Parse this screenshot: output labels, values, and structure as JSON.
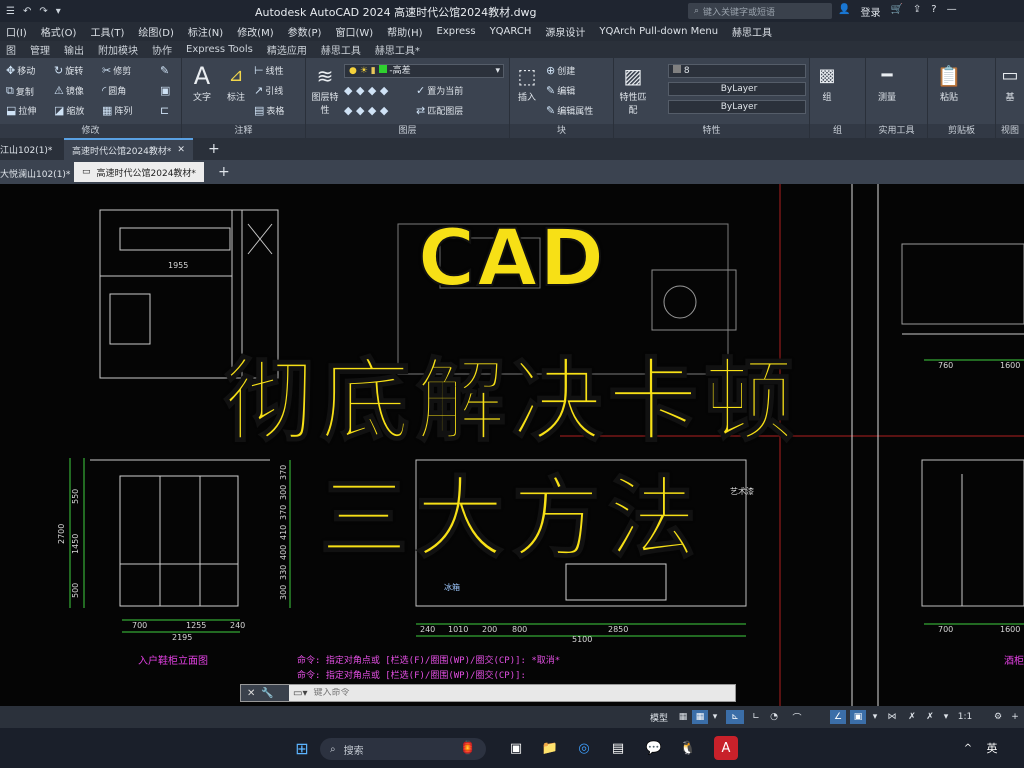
{
  "titlebar": {
    "title": "Autodesk AutoCAD 2024    高速时代公馆2024教材.dwg",
    "search_placeholder": "键入关键字或短语",
    "login": "登录"
  },
  "menubar": [
    "口(I)",
    "格式(O)",
    "工具(T)",
    "绘图(D)",
    "标注(N)",
    "修改(M)",
    "参数(P)",
    "窗口(W)",
    "帮助(H)",
    "Express",
    "YQARCH",
    "源泉设计",
    "YQArch Pull-down Menu",
    "赫思工具"
  ],
  "ribbon_tabs": [
    "图",
    "管理",
    "输出",
    "附加模块",
    "协作",
    "Express Tools",
    "精选应用",
    "赫思工具",
    "赫思工具*"
  ],
  "ribbon": {
    "modify": {
      "title": "修改",
      "buttons": [
        "移动",
        "旋转",
        "修剪",
        "复制",
        "镜像",
        "圆角",
        "拉伸",
        "缩放",
        "阵列"
      ]
    },
    "annotation": {
      "title": "注释",
      "text": "文字",
      "dim": "标注",
      "linear": "线性",
      "leader": "引线",
      "table": "表格"
    },
    "layers": {
      "title": "图层",
      "props": "图层特性",
      "current_layer": "-高差",
      "set_current": "置为当前",
      "match": "匹配图层"
    },
    "block": {
      "title": "块",
      "insert": "插入",
      "create": "创建",
      "edit": "编辑",
      "edit_attr": "编辑属性"
    },
    "properties": {
      "title": "特性",
      "match": "特性匹配",
      "color": "8",
      "linetype": "ByLayer",
      "lineweight": "ByLayer"
    },
    "group": {
      "title": "组",
      "label": "组"
    },
    "utilities": {
      "title": "实用工具",
      "measure": "测量"
    },
    "clipboard": {
      "title": "剪贴板",
      "paste": "粘贴"
    },
    "view": {
      "title": "视图",
      "base": "基"
    }
  },
  "file_tabs_top": [
    "江山102(1)*",
    "高速时代公馆2024教材*"
  ],
  "file_tabs_bottom": [
    "大悦澜山102(1)*",
    "高速时代公馆2024教材*"
  ],
  "drawing_labels": {
    "dim_1955": "1955",
    "left_dims_bottom": [
      "700",
      "1255",
      "240"
    ],
    "left_total": "2195",
    "left_vert": [
      "550",
      "1450",
      "500",
      "2700"
    ],
    "mid_vert": [
      "370",
      "300",
      "370",
      "410",
      "400",
      "330",
      "300"
    ],
    "mid_dims": [
      "240",
      "1010",
      "200",
      "800",
      "2850"
    ],
    "mid_total": "5100",
    "right_dims": [
      "760",
      "1600"
    ],
    "right_dims_bottom": [
      "700",
      "1600"
    ],
    "left_caption": "入户鞋柜立面图",
    "mid_label": "冰箱",
    "mid_label2": "艺术漆",
    "right_caption": "酒柜"
  },
  "headline": [
    "CAD",
    "彻底解决卡顿",
    "三大方法"
  ],
  "command_history": [
    "命令: 指定对角点或 [栏选(F)/圈围(WP)/圈交(CP)]: *取消*",
    "命令: 指定对角点或 [栏选(F)/圈围(WP)/圈交(CP)]:"
  ],
  "command_placeholder": "键入命令",
  "status": {
    "model": "模型",
    "scale": "1:1"
  },
  "taskbar": {
    "search": "搜索",
    "lang": "英"
  }
}
